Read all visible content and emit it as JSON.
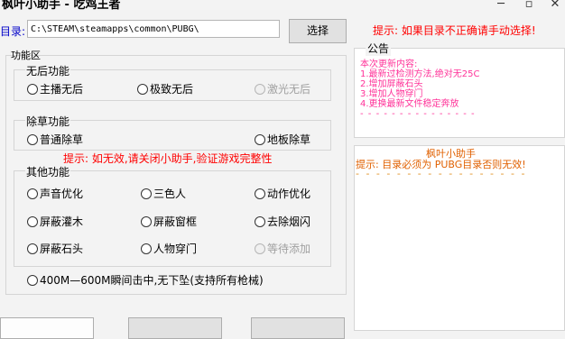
{
  "window": {
    "title": "枫叶小助手 - 吃鸡王者",
    "minimize": "─",
    "maximize": "▫",
    "close": "✕"
  },
  "directory": {
    "label": "目录:",
    "value": "C:\\STEAM\\steamapps\\common\\PUBG\\",
    "browse_label": "选择"
  },
  "top_hint": "提示: 如果目录不正确请手动选择!",
  "function_area_label": "功能区",
  "no_recoil": {
    "title": "无后功能",
    "options": [
      "主播无后",
      "极致无后",
      "激光无后"
    ]
  },
  "grass": {
    "title": "除草功能",
    "options": [
      "普通除草",
      "地板除草"
    ]
  },
  "red_hint": "提示: 如无效,请关闭小助手,验证游戏完整性",
  "other": {
    "title": "其他功能",
    "options": [
      "声音优化",
      "三色人",
      "动作优化",
      "屏蔽灌木",
      "屏蔽窗框",
      "去除烟闪",
      "屏蔽石头",
      "人物穿门",
      "等待添加"
    ]
  },
  "instant_hit": "400M—600M瞬间击中,无下坠(支持所有枪械)",
  "notice": {
    "title": "公告",
    "lines": [
      "本次更新内容:",
      "1.最新过检测方法,绝对无25C",
      "2.增加屏蔽石头",
      "3.增加人物穿门",
      "4.更换最新文件稳定奔放"
    ],
    "dash": "- - - - - - - - - - - - - - -"
  },
  "side": {
    "title": "枫叶小助手",
    "hint": "提示: 目录必须为 PUBG目录否则无效!",
    "dash": "- - - - - - - - - - - - - - - - -"
  },
  "colors": {
    "red": "#ff0000",
    "pink": "#ff3399",
    "orange": "#e06000",
    "blue": "#0000c8"
  }
}
